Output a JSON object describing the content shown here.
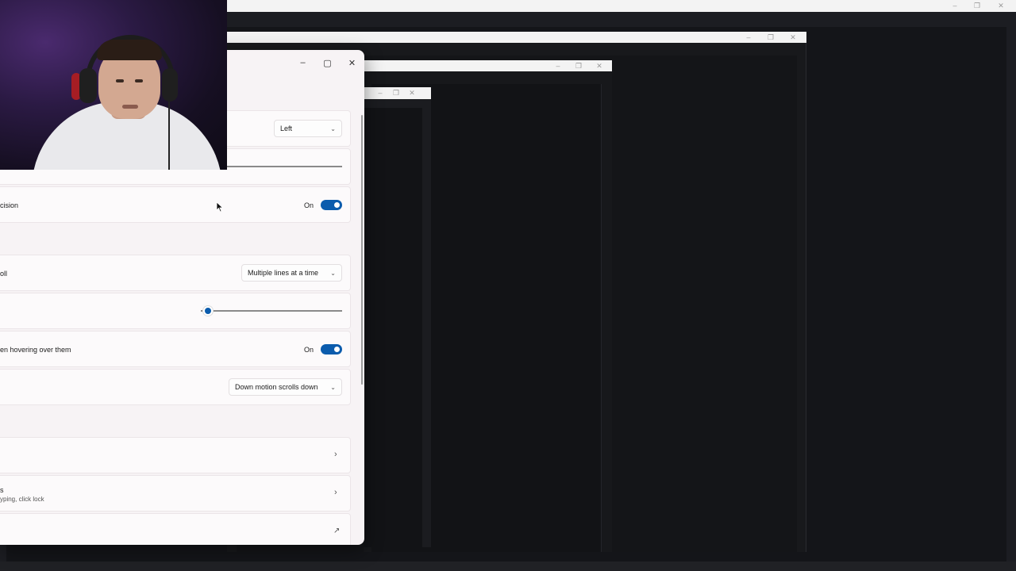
{
  "background": {
    "outer_controls": [
      "–",
      "❐",
      "✕"
    ],
    "win2_controls": [
      "–",
      "❐",
      "✕"
    ],
    "win3_controls": [
      "–",
      "❐",
      "✕"
    ],
    "win4_controls": [
      "–",
      "❐",
      "✕"
    ]
  },
  "settings": {
    "window_controls": {
      "minimize": "–",
      "maximize": "▢",
      "close": "✕"
    },
    "primary_button": {
      "value": "Left"
    },
    "pointer_precision": {
      "label": "cision",
      "state": "On",
      "enabled": true
    },
    "scroll_mode": {
      "label": "oll",
      "value": "Multiple lines at a time"
    },
    "scroll_lines_slider": {
      "value_fraction": 0.05
    },
    "hover_scroll": {
      "label": "en hovering over them",
      "state": "On",
      "enabled": true
    },
    "scroll_direction": {
      "value": "Down motion scrolls down"
    },
    "link_1": {
      "icon": "chevron-right-icon"
    },
    "link_2": {
      "title": "s",
      "subtitle": "yping, click lock",
      "icon": "chevron-right-icon"
    },
    "link_3": {
      "icon": "external-link-icon"
    }
  },
  "colors": {
    "accent": "#0b5cad",
    "settings_bg": "#f7f3f5",
    "card_bg": "#fcfafb",
    "desktop_dark": "#141519"
  }
}
